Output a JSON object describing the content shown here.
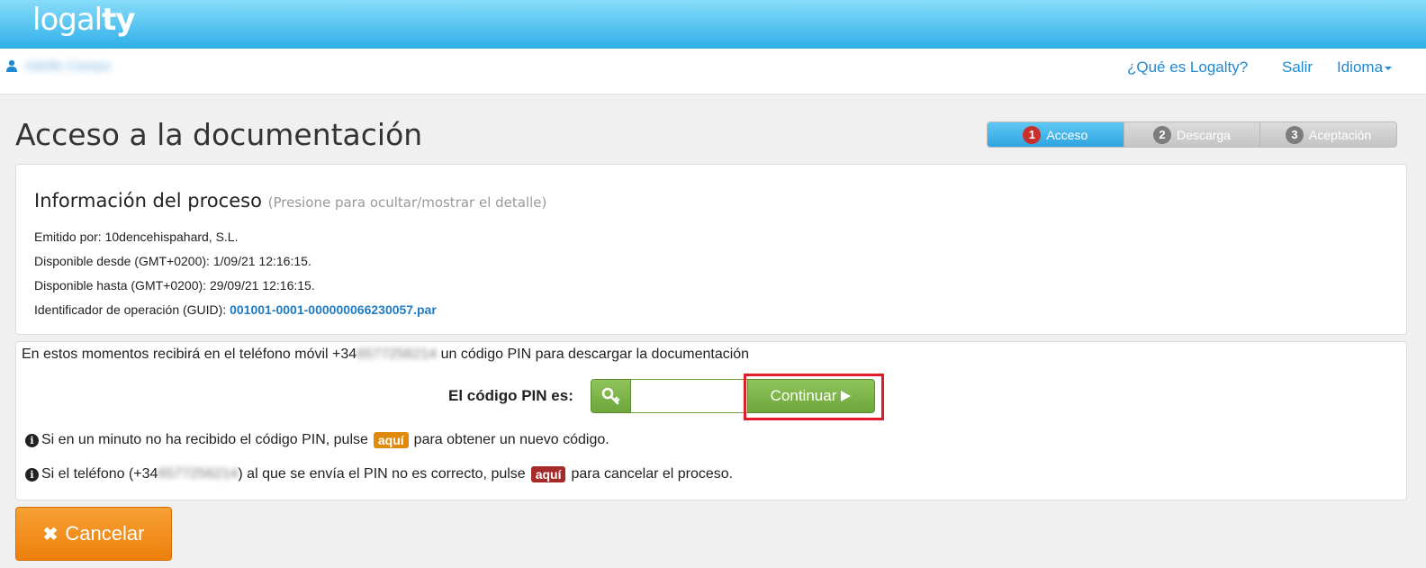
{
  "header": {
    "logo_light": "logal",
    "logo_bold": "ty",
    "user_name": "Adolfo Campo",
    "links": {
      "what_is": "¿Qué es Logalty?",
      "logout": "Salir",
      "language": "Idioma"
    }
  },
  "page": {
    "title": "Acceso a la documentación"
  },
  "steps": [
    {
      "num": "1",
      "label": "Acceso",
      "active": true
    },
    {
      "num": "2",
      "label": "Descarga",
      "active": false
    },
    {
      "num": "3",
      "label": "Aceptación",
      "active": false
    }
  ],
  "info": {
    "heading": "Información del proceso",
    "hint": "(Presione para ocultar/mostrar el detalle)",
    "issued_by_label": "Emitido por: ",
    "issued_by_value": "10dencehispahard, S.L.",
    "available_from_label": "Disponible desde (GMT+0200): ",
    "available_from_value": "1/09/21 12:16:15.",
    "available_until_label": "Disponible hasta (GMT+0200): ",
    "available_until_value": "29/09/21 12:16:15.",
    "guid_label": "Identificador de operación (GUID): ",
    "guid_value": "001001-0001-000000066230057.par"
  },
  "pin": {
    "message_before": "En estos momentos recibirá en el teléfono móvil +34",
    "message_phone_hidden": "6577256214",
    "message_after": " un código PIN para descargar la documentación",
    "label": "El código PIN es:",
    "input_value": "",
    "continue_label": "Continuar",
    "note1_before": "Si en un minuto no ha recibido el código PIN, pulse",
    "note1_badge": "aquí",
    "note1_after": "para obtener un nuevo código.",
    "note2_before": "Si el teléfono (+34",
    "note2_phone_hidden": "6577256214",
    "note2_middle": ") al que se envía el PIN no es correcto, pulse",
    "note2_badge": "aquí",
    "note2_after": "para cancelar el proceso."
  },
  "actions": {
    "cancel_label": "Cancelar"
  },
  "colors": {
    "header_blue": "#2fb0e8",
    "step_active": "#2fa4e0",
    "step_badge_active": "#c9302c",
    "green_button": "#6ea63c",
    "cancel_orange": "#ee7f0a",
    "badge_orange": "#e08a0b",
    "badge_red": "#a52a2a",
    "highlight_red": "#e21b2a",
    "link_blue": "#1e88d0"
  },
  "icons": {
    "user": "user-icon",
    "key": "key-icon",
    "play": "play-icon",
    "info": "info-circle-icon",
    "cancel": "close-icon"
  }
}
